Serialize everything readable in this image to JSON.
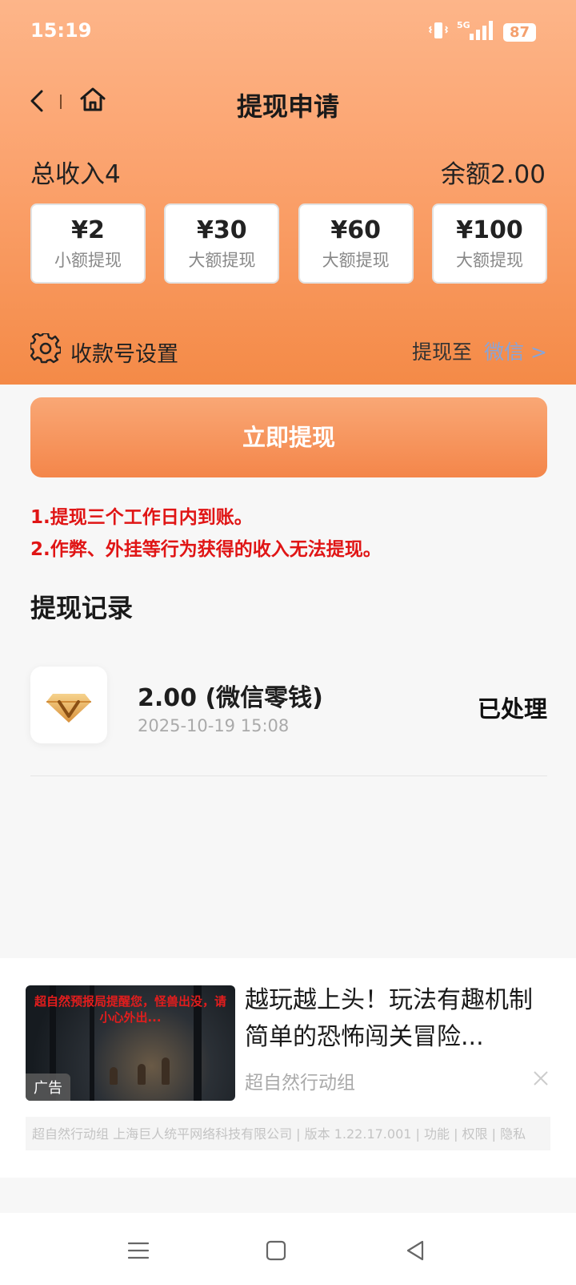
{
  "status_bar": {
    "time": "15:19",
    "network": "5G",
    "battery": "87"
  },
  "navbar": {
    "title": "提现申请"
  },
  "summary": {
    "total_income": "总收入4",
    "balance": "余额2.00"
  },
  "amount_options": [
    {
      "value": "¥2",
      "desc": "小额提现"
    },
    {
      "value": "¥30",
      "desc": "大额提现"
    },
    {
      "value": "¥60",
      "desc": "大额提现"
    },
    {
      "value": "¥100",
      "desc": "大额提现"
    }
  ],
  "account": {
    "label": "收款号设置",
    "withdraw_to": "提现至",
    "target": "微信 >"
  },
  "submit": {
    "label": "立即提现"
  },
  "notices": [
    "1.提现三个工作日内到账。",
    "2.作弊、外挂等行为获得的收入无法提现。"
  ],
  "records": {
    "title": "提现记录",
    "items": [
      {
        "amount": "2.00 (微信零钱)",
        "time": "2025-10-19 15:08",
        "status": "已处理"
      }
    ]
  },
  "ad": {
    "image_headline": "超自然预报局提醒您，怪兽出没，请小心外出...",
    "tag": "广告",
    "title": "越玩越上头！玩法有趣机制简单的恐怖闯关冒险...",
    "brand": "超自然行动组",
    "footer": "超自然行动组 上海巨人统平网络科技有限公司 | 版本 1.22.17.001 | 功能 | 权限 | 隐私"
  },
  "colors": {
    "accent": "#f48a47",
    "notice": "#e01515",
    "link": "#88a4d8"
  }
}
